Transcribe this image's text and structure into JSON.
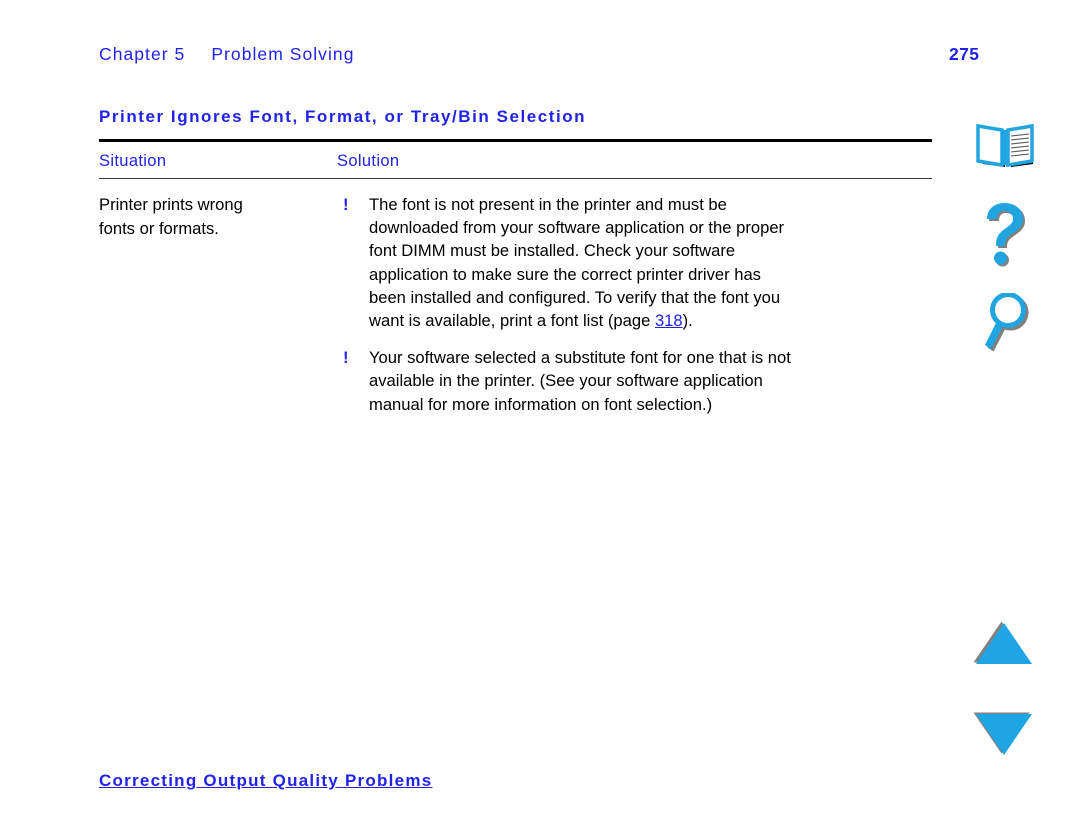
{
  "header": {
    "chapter_label": "Chapter 5",
    "chapter_title": "Problem Solving",
    "page_number": "275"
  },
  "section": {
    "heading": "Printer Ignores Font, Format, or Tray/Bin Selection"
  },
  "table": {
    "columns": {
      "situation": "Situation",
      "solution": "Solution"
    },
    "rows": [
      {
        "situation_lines": [
          "Printer prints wrong",
          "fonts or formats."
        ],
        "solutions": [
          {
            "marker": "!",
            "lines": [
              "The font is not present in the printer and must be",
              "downloaded from your software application or the proper",
              "font DIMM must be installed. Check your software",
              "application to make sure the correct printer driver has",
              "been installed and configured. To verify that the font you",
              "want is available, print a font list (page "
            ],
            "link_text": "318",
            "tail": ")."
          },
          {
            "marker": "!",
            "lines": [
              "Your software selected a substitute font for one that is not",
              "available in the printer. (See your software application",
              "manual for more information on font selection.)"
            ],
            "link_text": "",
            "tail": ""
          }
        ]
      }
    ]
  },
  "footer": {
    "link_label": "Correcting Output Quality Problems"
  },
  "navrail": {
    "items": [
      {
        "name": "book-icon",
        "label": "Contents"
      },
      {
        "name": "question-mark-icon",
        "label": "Help"
      },
      {
        "name": "magnifying-glass-icon",
        "label": "Search"
      },
      {
        "name": "triangle-up-icon",
        "label": "Previous Page"
      },
      {
        "name": "triangle-down-icon",
        "label": "Next Page"
      }
    ]
  },
  "colors": {
    "link_blue": "#2222e8",
    "icon_cyan": "#21a5e0",
    "icon_shadow": "#808080",
    "rule_black": "#000000",
    "body_text": "#000000"
  }
}
